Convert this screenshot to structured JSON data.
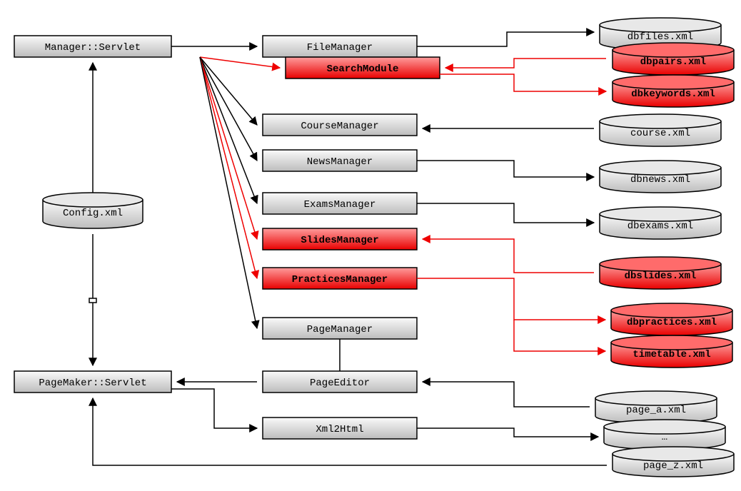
{
  "left": {
    "manager": "Manager::Servlet",
    "config": "Config.xml",
    "pagemaker": "PageMaker::Servlet"
  },
  "modules": {
    "file": "FileManager",
    "search": "SearchModule",
    "course": "CourseManager",
    "news": "NewsManager",
    "exams": "ExamsManager",
    "slides": "SlidesManager",
    "practices": "PracticesManager",
    "page": "PageManager",
    "editor": "PageEditor",
    "xml2html": "Xml2Html"
  },
  "db": {
    "files": "dbfiles.xml",
    "pairs": "dbpairs.xml",
    "keywords": "dbkeywords.xml",
    "course": "course.xml",
    "news": "dbnews.xml",
    "exams": "dbexams.xml",
    "slides": "dbslides.xml",
    "practices": "dbpractices.xml",
    "timetable": "timetable.xml",
    "pagea": "page_a.xml",
    "dots": "…",
    "pagez": "page_z.xml"
  }
}
